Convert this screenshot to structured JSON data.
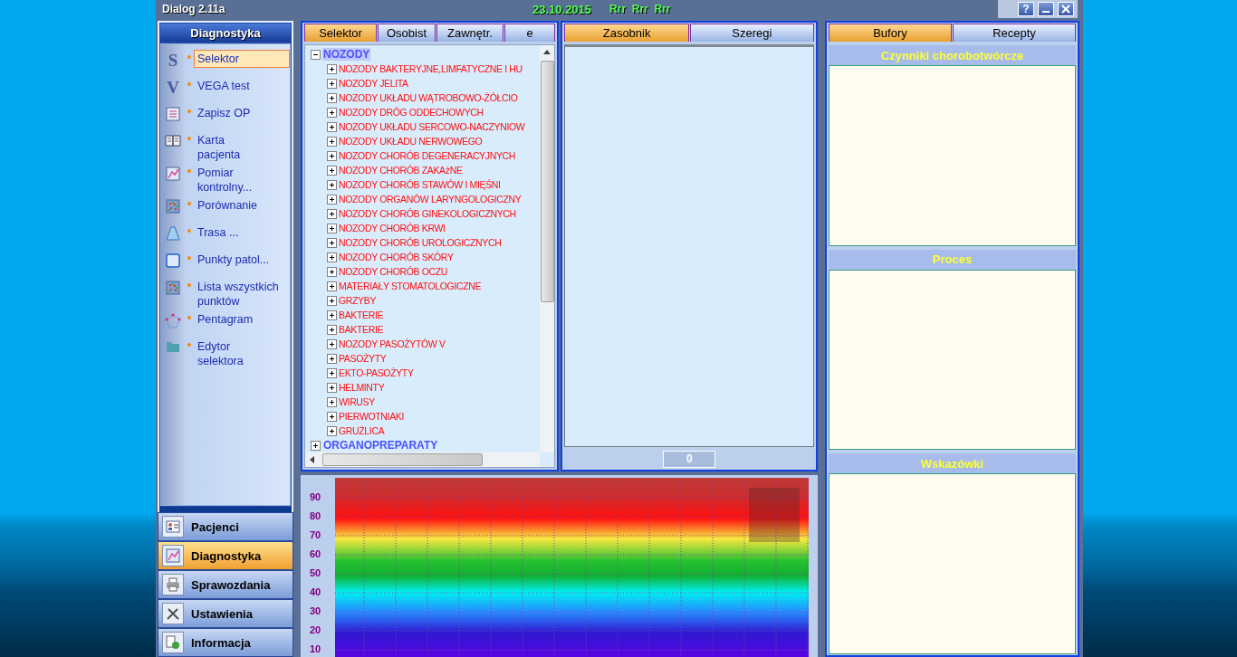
{
  "window": {
    "title": "Dialog 2.11a",
    "date": "23.10.2015",
    "status": "Rrr  Rrr  Rrr",
    "controls": [
      {
        "kind": "help",
        "label": "?"
      },
      {
        "kind": "minimize"
      },
      {
        "kind": "close"
      }
    ]
  },
  "sidebar": {
    "title": "Diagnostyka",
    "items": [
      {
        "label": "Selektor",
        "kind": "letter",
        "glyph": "S",
        "selected": true
      },
      {
        "label": "VEGA test",
        "kind": "letter",
        "glyph": "V",
        "selected": false
      },
      {
        "label": "Zapisz OP",
        "kind": "list",
        "selected": false
      },
      {
        "label": "Karta\npacjenta",
        "kind": "book",
        "selected": false
      },
      {
        "label": "Pomiar\nkontrolny...",
        "kind": "graph",
        "selected": false
      },
      {
        "label": "Porównanie",
        "kind": "grid",
        "selected": false
      },
      {
        "label": "Trasa ...",
        "kind": "road",
        "selected": false
      },
      {
        "label": "Punkty patol...",
        "kind": "square",
        "selected": false
      },
      {
        "label": "Lista wszystkich\npunktów",
        "kind": "grid",
        "selected": false
      },
      {
        "label": "Pentagram",
        "kind": "pentagon",
        "selected": false
      },
      {
        "label": "Edytor\nselektora",
        "kind": "folder",
        "selected": false
      }
    ],
    "nav": [
      {
        "label": "Pacjenci",
        "kind": "card",
        "selected": false
      },
      {
        "label": "Diagnostyka",
        "kind": "graph",
        "selected": true
      },
      {
        "label": "Sprawozdania",
        "kind": "printer",
        "selected": false
      },
      {
        "label": "Ustawienia",
        "kind": "tools",
        "selected": false
      },
      {
        "label": "Informacja",
        "kind": "info",
        "selected": false
      }
    ]
  },
  "selector_panel": {
    "tabs": [
      {
        "label": "Selektor",
        "selected": true
      },
      {
        "label": "Osobist",
        "selected": false
      },
      {
        "label": "Zawnętr.",
        "selected": false
      },
      {
        "label": "e",
        "selected": false
      }
    ],
    "tree": [
      {
        "label": "NOZODY",
        "expanded": true,
        "selected": true,
        "children": [
          {
            "label": "NOZODY BAKTERYJNE,LIMFATYCZNE I HU"
          },
          {
            "label": "NOZODY JELITA"
          },
          {
            "label": "NOZODY UKŁADU WĄTROBOWO-ŻÓŁCIO"
          },
          {
            "label": "NOZODY DRÓG ODDECHOWYCH"
          },
          {
            "label": "NOZODY UKŁADU SERCOWO-NACZYNIOW"
          },
          {
            "label": "NOZODY UKŁADU NERWOWEGO"
          },
          {
            "label": "NOZODY CHORÓB DEGENERACYJNYCH"
          },
          {
            "label": "NOZODY CHORÓB ZAKAżNE"
          },
          {
            "label": "NOZODY CHORÓB STAWÓW I MIĘŚNI"
          },
          {
            "label": "NOZODY ORGANÓW LARYNGOLOGICZNY"
          },
          {
            "label": "NOZODY CHORÓB GINEKOLOGICZNYCH"
          },
          {
            "label": "NOZODY CHORÓB KRWI"
          },
          {
            "label": "NOZODY CHORÓB UROLOGICZNYCH"
          },
          {
            "label": "NOZODY CHORÓB SKÓRY"
          },
          {
            "label": "NOZODY CHORÓB OCZU"
          },
          {
            "label": "MATERIAŁY STOMATOLOGICZNE"
          },
          {
            "label": "GRZYBY"
          },
          {
            "label": "BAKTERIE"
          },
          {
            "label": "BAKTERIE"
          },
          {
            "label": "NOZODY PASOŻYTÓW V"
          },
          {
            "label": "PASOŻYTY"
          },
          {
            "label": "EKTO-PASOŻYTY"
          },
          {
            "label": "HELMINTY"
          },
          {
            "label": "WIRUSY"
          },
          {
            "label": "PIERWOTNIAKI"
          },
          {
            "label": "GRUŹLICA"
          }
        ]
      },
      {
        "label": "ORGANOPREPARATY",
        "expanded": false,
        "selected": false
      }
    ]
  },
  "store_panel": {
    "tabs": [
      {
        "label": "Zasobnik",
        "selected": true
      },
      {
        "label": "Szeregi",
        "selected": false
      }
    ],
    "count": "0"
  },
  "scale": {
    "labels": [
      "90",
      "80",
      "70",
      "60",
      "50",
      "40",
      "30",
      "20",
      "10"
    ]
  },
  "buffers_panel": {
    "tabs": [
      {
        "label": "Bufory",
        "selected": true
      },
      {
        "label": "Recepty",
        "selected": false
      }
    ],
    "sections": [
      {
        "title": "Czynniki chorobotwórcze"
      },
      {
        "title": "Proces"
      },
      {
        "title": "Wskazówki"
      }
    ]
  }
}
